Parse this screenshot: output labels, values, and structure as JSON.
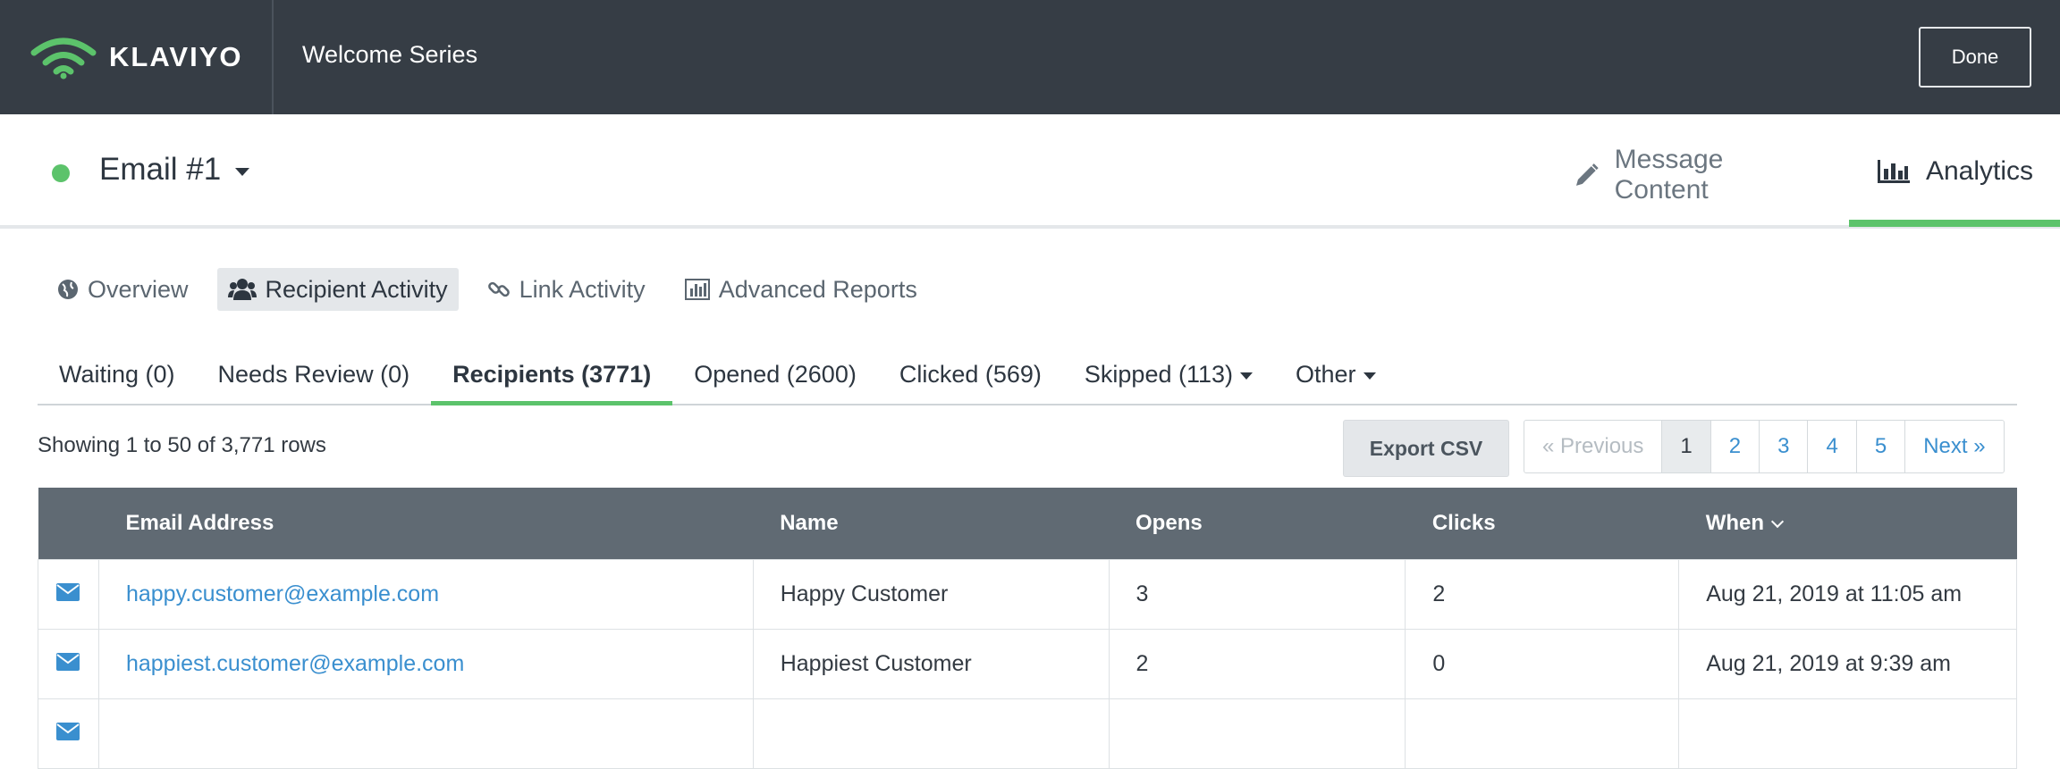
{
  "header": {
    "brand": "KLAVIYO",
    "flow_title": "Welcome Series",
    "done_label": "Done"
  },
  "message": {
    "name": "Email #1",
    "status_color": "#5cc36b"
  },
  "right_tabs": [
    {
      "label": "Message Content",
      "icon": "pencil-icon",
      "active": false
    },
    {
      "label": "Analytics",
      "icon": "bar-chart-icon",
      "active": true
    }
  ],
  "subnav": [
    {
      "label": "Overview",
      "icon": "globe-icon",
      "active": false
    },
    {
      "label": "Recipient Activity",
      "icon": "users-icon",
      "active": true
    },
    {
      "label": "Link Activity",
      "icon": "link-icon",
      "active": false
    },
    {
      "label": "Advanced Reports",
      "icon": "bar-chart-icon",
      "active": false
    }
  ],
  "filters": [
    {
      "label": "Waiting (0)",
      "active": false
    },
    {
      "label": "Needs Review (0)",
      "active": false
    },
    {
      "label": "Recipients (3771)",
      "active": true
    },
    {
      "label": "Opened (2600)",
      "active": false
    },
    {
      "label": "Clicked (569)",
      "active": false
    },
    {
      "label": "Skipped (113)",
      "active": false,
      "dropdown": true
    },
    {
      "label": "Other",
      "active": false,
      "dropdown": true
    }
  ],
  "showing": "Showing 1 to 50 of 3,771 rows",
  "export_label": "Export CSV",
  "pagination": {
    "previous": "« Previous",
    "pages": [
      "1",
      "2",
      "3",
      "4",
      "5"
    ],
    "current": "1",
    "next": "Next »"
  },
  "table": {
    "columns": [
      "Email Address",
      "Name",
      "Opens",
      "Clicks",
      "When"
    ],
    "rows": [
      {
        "email": "happy.customer@example.com",
        "name": "Happy Customer",
        "opens": "3",
        "clicks": "2",
        "when": "Aug 21, 2019 at 11:05 am"
      },
      {
        "email": "happiest.customer@example.com",
        "name": "Happiest Customer",
        "opens": "2",
        "clicks": "0",
        "when": "Aug 21, 2019 at 9:39 am"
      },
      {
        "email": "",
        "name": "",
        "opens": "",
        "clicks": "",
        "when": ""
      }
    ]
  },
  "colors": {
    "accent_green": "#5cc36b",
    "link_blue": "#3a8fcf",
    "topbar": "#363d45",
    "table_header": "#606a73"
  }
}
